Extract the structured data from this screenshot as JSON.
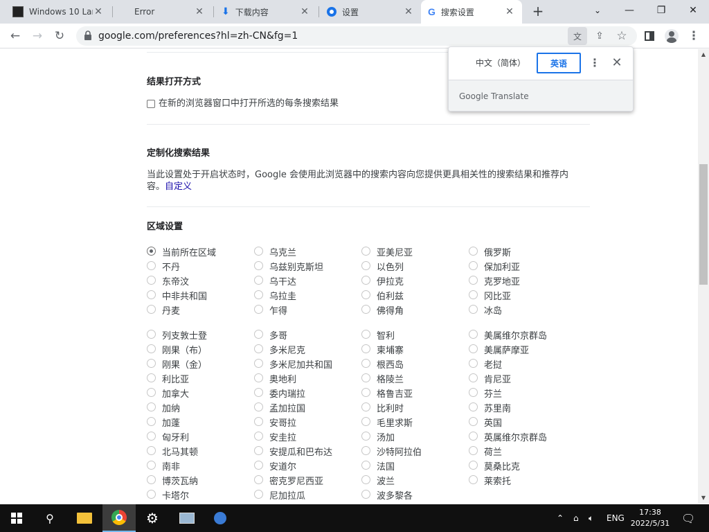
{
  "tabs": [
    {
      "title": "Windows 10 Lar",
      "icon": "app-icon"
    },
    {
      "title": "Error",
      "icon": ""
    },
    {
      "title": "下载内容",
      "icon": "download-icon"
    },
    {
      "title": "设置",
      "icon": "gear-icon"
    },
    {
      "title": "搜索设置",
      "icon": "google-icon",
      "active": true
    }
  ],
  "toolbar": {
    "url": "google.com/preferences?hl=zh-CN&fg=1"
  },
  "translate_popup": {
    "source_lang": "中文（简体）",
    "target_lang": "英语",
    "footer": "Google Translate"
  },
  "page": {
    "results_open": {
      "heading": "结果打开方式",
      "checkbox_label": "在新的浏览器窗口中打开所选的每条搜索结果"
    },
    "custom_results": {
      "heading": "定制化搜索结果",
      "desc_line1": "当此设置处于开启状态时，Google 会使用此浏览器中的搜索内容向您提供更具相关性的搜索结果和推荐内",
      "desc_line2_prefix": "容。",
      "desc_link": "自定义"
    },
    "region": {
      "heading": "区域设置",
      "group1": [
        [
          "当前所在区域",
          "不丹",
          "东帝汶",
          "中非共和国",
          "丹麦"
        ],
        [
          "乌克兰",
          "乌兹别克斯坦",
          "乌干达",
          "乌拉圭",
          "乍得"
        ],
        [
          "亚美尼亚",
          "以色列",
          "伊拉克",
          "伯利兹",
          "佛得角"
        ],
        [
          "俄罗斯",
          "保加利亚",
          "克罗地亚",
          "冈比亚",
          "冰岛"
        ]
      ],
      "group2": [
        [
          "列支敦士登",
          "刚果（布）",
          "刚果（金）",
          "利比亚",
          "加拿大",
          "加纳",
          "加蓬",
          "匈牙利",
          "北马其顿",
          "南非",
          "博茨瓦纳",
          "卡塔尔"
        ],
        [
          "多哥",
          "多米尼克",
          "多米尼加共和国",
          "奥地利",
          "委内瑞拉",
          "孟加拉国",
          "安哥拉",
          "安圭拉",
          "安提瓜和巴布达",
          "安道尔",
          "密克罗尼西亚",
          "尼加拉瓜"
        ],
        [
          "智利",
          "柬埔寨",
          "根西岛",
          "格陵兰",
          "格鲁吉亚",
          "比利时",
          "毛里求斯",
          "汤加",
          "沙特阿拉伯",
          "法国",
          "波兰",
          "波多黎各"
        ],
        [
          "美属维尔京群岛",
          "美属萨摩亚",
          "老挝",
          "肯尼亚",
          "芬兰",
          "苏里南",
          "英国",
          "英属维尔京群岛",
          "荷兰",
          "莫桑比克",
          "莱索托"
        ]
      ]
    }
  },
  "taskbar": {
    "lang": "ENG",
    "time": "17:38",
    "date": "2022/5/31"
  },
  "colors": {
    "accent": "#1a73e8",
    "link": "#1a0dab",
    "taskbar": "#101010"
  }
}
